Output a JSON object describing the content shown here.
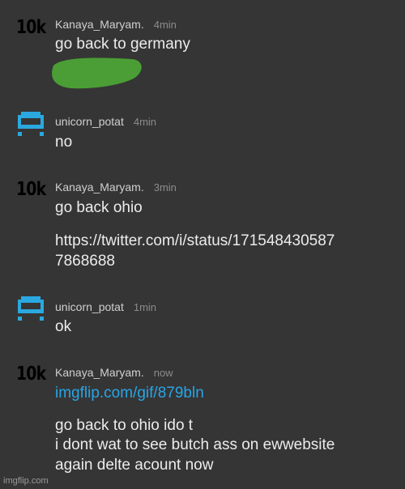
{
  "colors": {
    "background": "#353535",
    "link": "#27a6e6",
    "robot_icon": "#2aa8df",
    "blob": "#4a9e35"
  },
  "messages": [
    {
      "avatar": "10k",
      "user": "Kanaya_Maryam.",
      "time": "4min",
      "lines": [
        "go back to germany"
      ]
    },
    {
      "avatar": "robot-icon",
      "user": "unicorn_potat",
      "time": "4min",
      "lines": [
        "no"
      ]
    },
    {
      "avatar": "10k",
      "user": "Kanaya_Maryam.",
      "time": "3min",
      "lines": [
        "go back ohio",
        "https://twitter.com/i/status/171548430587",
        "7868688"
      ]
    },
    {
      "avatar": "robot-icon",
      "user": "unicorn_potat",
      "time": "1min",
      "lines": [
        "ok"
      ]
    },
    {
      "avatar": "10k",
      "user": "Kanaya_Maryam.",
      "time": "now",
      "link": "imgflip.com/gif/879bln",
      "lines": [
        "go back to ohio ido t",
        "i dont wat to see butch ass on ewwebsite",
        "again delte acount now"
      ]
    }
  ],
  "watermark": "imgflip.com"
}
